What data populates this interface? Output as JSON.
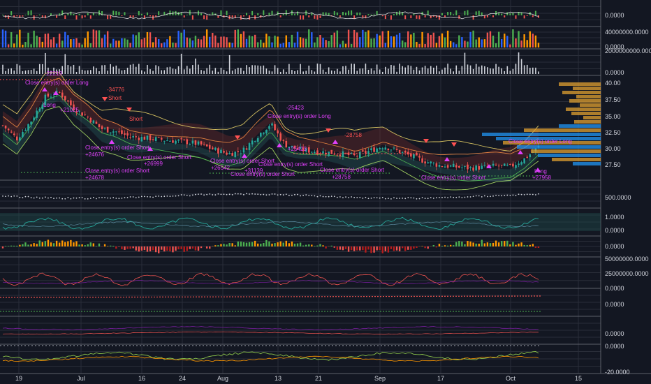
{
  "chart_data": {
    "type": "line",
    "title": "",
    "x_axis": {
      "tick_labels": [
        "19",
        "Jul",
        "16",
        "24",
        "Aug",
        "13",
        "21",
        "Sep",
        "17",
        "Oct",
        "15"
      ]
    },
    "panes": [
      {
        "id": "osc-top",
        "y_ticks": [
          "0.0000"
        ]
      },
      {
        "id": "volume-colored",
        "y_ticks": [
          "40000000.0000",
          "0.0000"
        ]
      },
      {
        "id": "volume-bars",
        "y_ticks": [
          "2000000000.0000",
          "0.0000"
        ]
      },
      {
        "id": "price",
        "type": "candlestick",
        "y_ticks": [
          "40.00",
          "37.50",
          "35.00",
          "32.50",
          "30.00",
          "27.50"
        ],
        "approx_close_path": [
          33.5,
          31.5,
          34.2,
          37.8,
          38.6,
          36.2,
          34.8,
          33.0,
          32.6,
          31.8,
          31.6,
          31.4,
          31.2,
          31.0,
          30.6,
          29.8,
          29.2,
          29.6,
          31.8,
          33.8,
          30.6,
          29.8,
          29.6,
          29.4,
          29.2,
          28.8,
          29.6,
          30.4,
          29.6,
          28.8,
          28.0,
          27.4,
          27.2,
          27.0,
          27.1,
          27.3,
          27.2,
          28.4,
          30.2
        ]
      },
      {
        "id": "dots",
        "y_ticks": [
          "500.0000"
        ]
      },
      {
        "id": "osc-1",
        "y_ticks": [
          "1.0000",
          "0.0000"
        ]
      },
      {
        "id": "histogram",
        "y_ticks": [
          "0.0000"
        ]
      },
      {
        "id": "vol-osc",
        "y_ticks": [
          "50000000.0000",
          "25000000.0000",
          "0.0000"
        ]
      },
      {
        "id": "flat-1",
        "y_ticks": [
          "0.0000"
        ]
      },
      {
        "id": "flat-2",
        "y_ticks": [
          "0.0000"
        ]
      },
      {
        "id": "osc-bottom",
        "y_ticks": [
          "0.0000",
          "-20.0000"
        ]
      }
    ],
    "annotations": [
      {
        "text": "-22219",
        "color": "#e040fb"
      },
      {
        "text": "Close entry(s) order Long",
        "color": "#e040fb"
      },
      {
        "text": "Long",
        "color": "#e040fb"
      },
      {
        "text": "+21025",
        "color": "#e040fb"
      },
      {
        "text": "-34776",
        "color": "#ff5252"
      },
      {
        "text": "Short",
        "color": "#ff5252"
      },
      {
        "text": "Short",
        "color": "#ff5252"
      },
      {
        "text": "-25423",
        "color": "#e040fb"
      },
      {
        "text": "Close entry(s) order Long",
        "color": "#e040fb"
      },
      {
        "text": "Close entry(s) order Short",
        "color": "#e040fb"
      },
      {
        "text": "+24676",
        "color": "#e040fb"
      },
      {
        "text": "Close entry(s) order Short",
        "color": "#e040fb"
      },
      {
        "text": "+26999",
        "color": "#e040fb"
      },
      {
        "text": "Close entry(s) order Short",
        "color": "#e040fb"
      },
      {
        "text": "+24678",
        "color": "#e040fb"
      },
      {
        "text": "Close entry(s) order Short",
        "color": "#e040fb"
      },
      {
        "text": "+26542",
        "color": "#e040fb"
      },
      {
        "text": "Close entry(s) order Short",
        "color": "#e040fb"
      },
      {
        "text": "+31139",
        "color": "#e040fb"
      },
      {
        "text": "Close entry(s) order Short",
        "color": "#e040fb"
      },
      {
        "text": "+25423",
        "color": "#e040fb"
      },
      {
        "text": "-28758",
        "color": "#ff5252"
      },
      {
        "text": "Close entry(s) order Short",
        "color": "#e040fb"
      },
      {
        "text": "+28758",
        "color": "#e040fb"
      },
      {
        "text": "Close entry(s) order Short",
        "color": "#e040fb"
      },
      {
        "text": "Close entry(s) order Long",
        "color": "#e040fb"
      },
      {
        "text": "Long",
        "color": "#e040fb"
      },
      {
        "text": "+27958",
        "color": "#e040fb"
      }
    ]
  },
  "colors": {
    "background": "#131722",
    "grid": "#2a2e39",
    "separator": "#d1d4dc",
    "up": "#26a69a",
    "down": "#ef5350",
    "signal": "#e040fb",
    "short": "#ff5252",
    "volume_profile_orange": "#e0a030",
    "volume_profile_blue": "#2196f3"
  }
}
